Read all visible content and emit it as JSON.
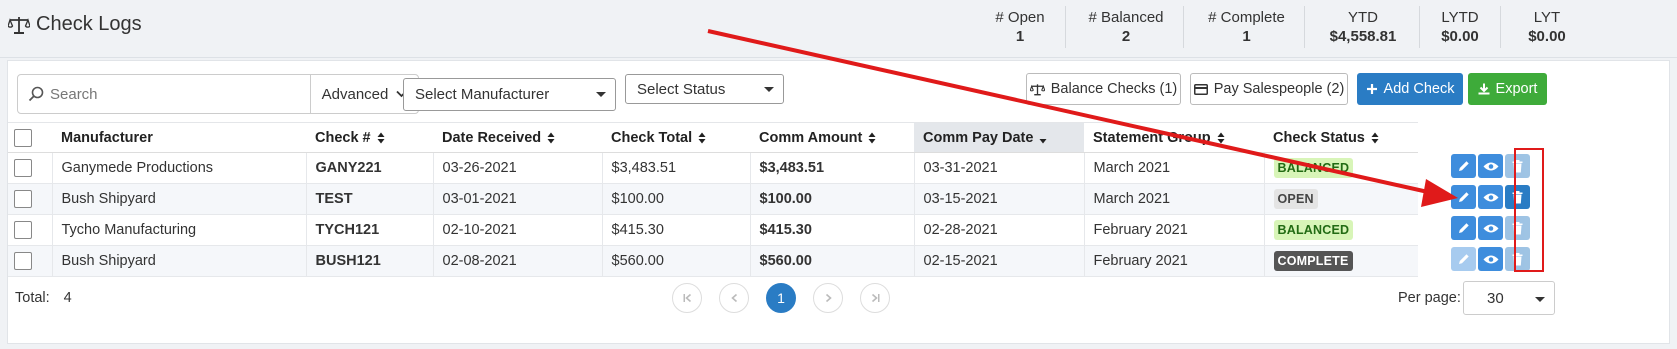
{
  "page": {
    "title": "Check Logs"
  },
  "stats": [
    {
      "label": "# Open",
      "value": "1"
    },
    {
      "label": "# Balanced",
      "value": "2"
    },
    {
      "label": "# Complete",
      "value": "1"
    },
    {
      "label": "YTD",
      "value": "$4,558.81"
    },
    {
      "label": "LYTD",
      "value": "$0.00"
    },
    {
      "label": "LYT",
      "value": "$0.00"
    }
  ],
  "toolbar": {
    "search_placeholder": "Search",
    "advanced_label": "Advanced",
    "manufacturer_select": "Select Manufacturer",
    "status_select": "Select Status",
    "balance_checks_label": "Balance Checks (1)",
    "pay_salespeople_label": "Pay Salespeople (2)",
    "add_check_label": "Add Check",
    "export_label": "Export"
  },
  "table": {
    "columns": [
      "Manufacturer",
      "Check #",
      "Date Received",
      "Check Total",
      "Comm Amount",
      "Comm Pay Date",
      "Statement Group",
      "Check Status"
    ],
    "rows": [
      {
        "manufacturer": "Ganymede Productions",
        "check_no": "GANY221",
        "date_received": "03-26-2021",
        "check_total": "$3,483.51",
        "comm_amount": "$3,483.51",
        "comm_pay_date": "03-31-2021",
        "statement_group": "March 2021",
        "status": "BALANCED"
      },
      {
        "manufacturer": "Bush Shipyard",
        "check_no": "TEST",
        "date_received": "03-01-2021",
        "check_total": "$100.00",
        "comm_amount": "$100.00",
        "comm_pay_date": "03-15-2021",
        "statement_group": "March 2021",
        "status": "OPEN"
      },
      {
        "manufacturer": "Tycho Manufacturing",
        "check_no": "TYCH121",
        "date_received": "02-10-2021",
        "check_total": "$415.30",
        "comm_amount": "$415.30",
        "comm_pay_date": "02-28-2021",
        "statement_group": "February 2021",
        "status": "BALANCED"
      },
      {
        "manufacturer": "Bush Shipyard",
        "check_no": "BUSH121",
        "date_received": "02-08-2021",
        "check_total": "$560.00",
        "comm_amount": "$560.00",
        "comm_pay_date": "02-15-2021",
        "statement_group": "February 2021",
        "status": "COMPLETE"
      }
    ]
  },
  "footer": {
    "total_label": "Total:",
    "total_value": "4",
    "current_page": "1",
    "per_page_label": "Per page:",
    "per_page_value": "30"
  },
  "colors": {
    "primary": "#2a7cc4",
    "success": "#3eab3a",
    "annotation": "#e01a1a"
  },
  "icons": [
    "balance-scale-icon",
    "search-icon",
    "chevron-down-icon",
    "credit-card-icon",
    "plus-icon",
    "download-icon",
    "sort-icon",
    "sort-desc-icon",
    "pencil-icon",
    "eye-icon",
    "trash-icon",
    "first-page-icon",
    "prev-page-icon",
    "next-page-icon",
    "last-page-icon"
  ]
}
